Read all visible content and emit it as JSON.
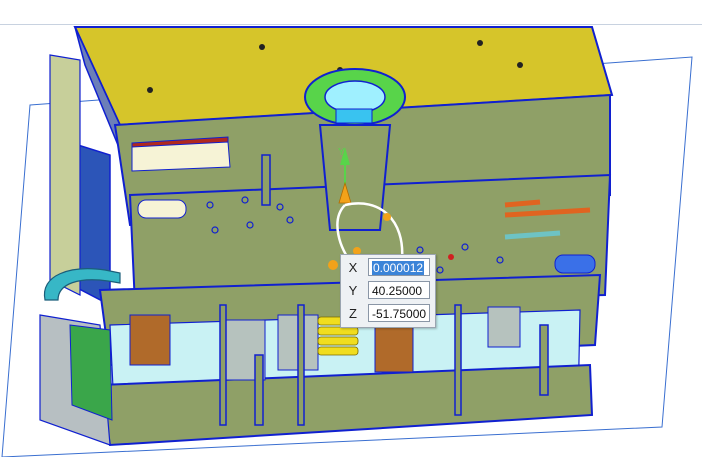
{
  "colors": {
    "plate_fill": "#8fa067",
    "edge_blue": "#1020d0",
    "top_plate": "#d6c52a",
    "sprue": "#58d44a",
    "accent_orange": "#f2a21a",
    "cylinder_gray": "#b6c2be",
    "cyan_pipe": "#37b7c6",
    "spring_yellow": "#f0dd1e",
    "red_insert": "#b0281e"
  },
  "viewport": {
    "name": "3D mold assembly section view"
  },
  "coord_input": {
    "x_label": "X",
    "x_value": "0.000012",
    "y_label": "Y",
    "y_value": "40.25000",
    "z_label": "Z",
    "z_value": "-51.75000"
  },
  "icons": {
    "manipulator": "axis-handle-icon"
  }
}
